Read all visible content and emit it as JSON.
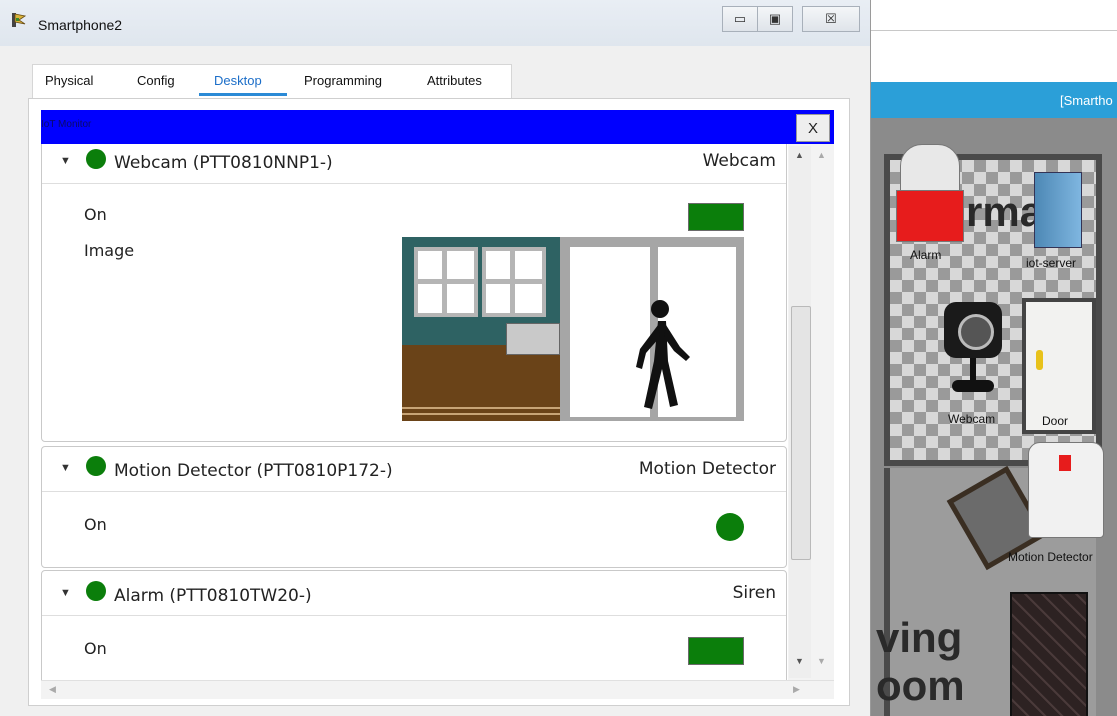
{
  "window": {
    "title": "Smartphone2",
    "controls": {
      "minimize": "▭",
      "maximize": "▣",
      "close": "☒"
    }
  },
  "tabs": [
    {
      "label": "Physical"
    },
    {
      "label": "Config"
    },
    {
      "label": "Desktop",
      "active": true
    },
    {
      "label": "Programming"
    },
    {
      "label": "Attributes"
    }
  ],
  "iot_monitor": {
    "title": "IoT Monitor",
    "close_label": "X"
  },
  "devices": [
    {
      "name": "Webcam (PTT0810NNP1-)",
      "type": "Webcam",
      "status_color": "#0b7e0b",
      "properties": {
        "on_label": "On",
        "image_label": "Image"
      }
    },
    {
      "name": "Motion Detector (PTT0810P172-)",
      "type": "Motion Detector",
      "status_color": "#0b7e0b",
      "properties": {
        "on_label": "On"
      }
    },
    {
      "name": "Alarm (PTT0810TW20-)",
      "type": "Siren",
      "status_color": "#0b7e0b",
      "properties": {
        "on_label": "On"
      }
    }
  ],
  "background_workspace": {
    "header_title": "[Smartho",
    "labels": {
      "alarm": "Alarm",
      "iot_server": "iot-server",
      "webcam": "Webcam",
      "door": "Door",
      "motion_detector": "Motion Detector"
    },
    "room_text": {
      "top": "rma",
      "bottom_1": "ving",
      "bottom_2": "oom"
    }
  },
  "colors": {
    "accent": "#0b7e0b",
    "iot_bar": "#0000ff",
    "active_tab": "#1c6ec8"
  }
}
